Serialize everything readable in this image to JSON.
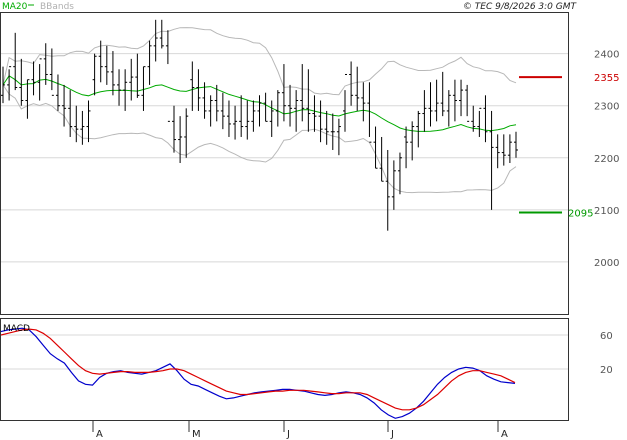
{
  "chart_data": [
    {
      "type": "ohlc",
      "legend": [
        {
          "name": "MA20",
          "color": "#00aa00"
        },
        {
          "name": "BBands",
          "color": "#b0b0b0"
        }
      ],
      "copyright": "© TEC 9/8/2026 3:0 GMT",
      "ylim": [
        1900,
        2480
      ],
      "yticks": [
        2000,
        2100,
        2200,
        2300,
        2400
      ],
      "xlabels": [
        "A",
        "M",
        "J",
        "J",
        "A"
      ],
      "levels": [
        {
          "value": 2355,
          "label": "2355",
          "color": "#cc0000"
        },
        {
          "value": 2095,
          "label": "2095",
          "color": "#009900"
        }
      ],
      "series": [
        {
          "name": "price",
          "open": [
            2320,
            2340,
            2375,
            2335,
            2310,
            2350,
            2345,
            2390,
            2360,
            2320,
            2300,
            2295,
            2260,
            2255,
            2260,
            2350,
            2395,
            2375,
            2365,
            2340,
            2330,
            2345,
            2355,
            2320,
            2375,
            2415,
            2430,
            2415,
            2270,
            2235,
            2240,
            2350,
            2335,
            2315,
            2290,
            2310,
            2290,
            2280,
            2265,
            2270,
            2260,
            2270,
            2290,
            2305,
            2270,
            2290,
            2325,
            2300,
            2295,
            2310,
            2295,
            2285,
            2280,
            2255,
            2250,
            2250,
            2290,
            2360,
            2320,
            2315,
            2305,
            2230,
            2180,
            2155,
            2125,
            2175,
            2240,
            2230,
            2260,
            2285,
            2295,
            2290,
            2305,
            2290,
            2320,
            2310,
            2330,
            2270,
            2260,
            2295,
            2250,
            2220,
            2210,
            2205,
            2230
          ],
          "high": [
            2375,
            2370,
            2440,
            2390,
            2350,
            2385,
            2380,
            2420,
            2410,
            2360,
            2340,
            2330,
            2300,
            2290,
            2310,
            2400,
            2425,
            2415,
            2405,
            2370,
            2370,
            2390,
            2400,
            2375,
            2425,
            2465,
            2465,
            2445,
            2300,
            2280,
            2295,
            2385,
            2370,
            2345,
            2320,
            2340,
            2325,
            2310,
            2300,
            2320,
            2310,
            2310,
            2320,
            2325,
            2310,
            2330,
            2380,
            2340,
            2330,
            2380,
            2370,
            2320,
            2310,
            2290,
            2285,
            2275,
            2330,
            2385,
            2375,
            2345,
            2345,
            2260,
            2240,
            2215,
            2195,
            2210,
            2260,
            2270,
            2290,
            2330,
            2345,
            2350,
            2365,
            2330,
            2350,
            2350,
            2340,
            2300,
            2290,
            2320,
            2290,
            2245,
            2245,
            2245,
            2250
          ],
          "low": [
            2305,
            2310,
            2330,
            2300,
            2275,
            2320,
            2310,
            2340,
            2330,
            2290,
            2260,
            2240,
            2230,
            2225,
            2230,
            2320,
            2345,
            2340,
            2320,
            2300,
            2290,
            2310,
            2315,
            2290,
            2340,
            2385,
            2410,
            2380,
            2210,
            2190,
            2200,
            2290,
            2290,
            2275,
            2260,
            2270,
            2255,
            2240,
            2235,
            2240,
            2235,
            2250,
            2260,
            2270,
            2240,
            2260,
            2270,
            2260,
            2250,
            2270,
            2250,
            2250,
            2230,
            2225,
            2215,
            2205,
            2250,
            2300,
            2290,
            2270,
            2240,
            2180,
            2155,
            2060,
            2100,
            2130,
            2180,
            2195,
            2220,
            2250,
            2260,
            2270,
            2280,
            2260,
            2270,
            2280,
            2280,
            2250,
            2240,
            2230,
            2100,
            2180,
            2185,
            2190,
            2200
          ],
          "close": [
            2340,
            2375,
            2335,
            2310,
            2350,
            2345,
            2390,
            2360,
            2320,
            2300,
            2295,
            2260,
            2255,
            2260,
            2290,
            2395,
            2375,
            2365,
            2340,
            2330,
            2345,
            2355,
            2320,
            2375,
            2415,
            2430,
            2415,
            2270,
            2235,
            2240,
            2280,
            2335,
            2315,
            2290,
            2310,
            2290,
            2280,
            2265,
            2270,
            2260,
            2270,
            2290,
            2305,
            2270,
            2290,
            2325,
            2300,
            2295,
            2310,
            2295,
            2285,
            2280,
            2255,
            2250,
            2250,
            2260,
            2360,
            2320,
            2315,
            2305,
            2230,
            2180,
            2155,
            2125,
            2175,
            2200,
            2230,
            2260,
            2285,
            2295,
            2290,
            2305,
            2290,
            2320,
            2310,
            2330,
            2270,
            2260,
            2295,
            2250,
            2220,
            2210,
            2205,
            2230,
            2215
          ]
        }
      ]
    },
    {
      "type": "line",
      "title": "MACD",
      "ylim": [
        -40,
        80
      ],
      "yticks": [
        20,
        60
      ],
      "series": [
        {
          "name": "",
          "color": "#0000cc",
          "values": [
            64,
            66,
            67,
            68,
            66,
            58,
            48,
            38,
            32,
            27,
            16,
            6,
            2,
            1,
            10,
            15,
            17,
            18,
            16,
            15,
            14,
            16,
            18,
            22,
            26,
            18,
            8,
            2,
            0,
            -4,
            -8,
            -12,
            -15,
            -14,
            -12,
            -10,
            -8,
            -7,
            -6,
            -5,
            -4,
            -4,
            -5,
            -6,
            -8,
            -10,
            -11,
            -10,
            -8,
            -7,
            -8,
            -10,
            -14,
            -20,
            -28,
            -34,
            -38,
            -36,
            -32,
            -26,
            -18,
            -8,
            2,
            10,
            16,
            20,
            22,
            21,
            18,
            12,
            8,
            5,
            4,
            3
          ]
        },
        {
          "name": "",
          "color": "#dd0000",
          "values": [
            60,
            62,
            64,
            66,
            67,
            66,
            62,
            56,
            48,
            40,
            32,
            24,
            18,
            15,
            14,
            15,
            16,
            17,
            17,
            16,
            16,
            16,
            17,
            18,
            20,
            20,
            18,
            14,
            10,
            6,
            2,
            -2,
            -6,
            -8,
            -10,
            -10,
            -9,
            -8,
            -7,
            -6,
            -6,
            -5,
            -5,
            -5,
            -6,
            -7,
            -8,
            -9,
            -9,
            -8,
            -8,
            -8,
            -10,
            -14,
            -18,
            -22,
            -26,
            -28,
            -28,
            -26,
            -22,
            -16,
            -10,
            -2,
            6,
            12,
            16,
            18,
            18,
            16,
            14,
            12,
            8,
            4
          ]
        }
      ]
    }
  ]
}
